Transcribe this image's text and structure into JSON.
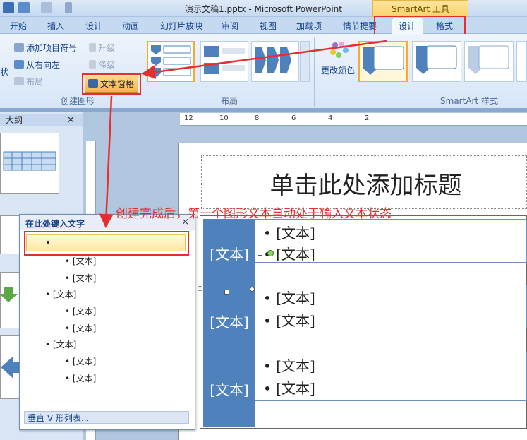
{
  "window": {
    "title": "演示文稿1.pptx - Microsoft PowerPoint",
    "context_tools": "SmartArt 工具"
  },
  "tabs": [
    "开始",
    "插入",
    "设计",
    "动画",
    "幻灯片放映",
    "审阅",
    "视图",
    "加载项",
    "情节提要"
  ],
  "context_tabs": {
    "design": "设计",
    "format": "格式"
  },
  "ribbon": {
    "create_graphic": {
      "add_bullet": "添加项目符号",
      "right_to_left": "从右向左",
      "layout": "布局",
      "promote": "升级",
      "demote": "降级",
      "text_pane": "文本窗格",
      "shape_cut": "状",
      "label": "创建图形"
    },
    "layout_group": {
      "label": "布局"
    },
    "styles_group": {
      "change_colors": "更改颜色",
      "label": "SmartArt 样式"
    }
  },
  "left_panel": {
    "outline_tab": "大纲",
    "close": "×"
  },
  "ruler": {
    "h_marks": [
      "12",
      "10",
      "8",
      "6",
      "4",
      "2"
    ]
  },
  "slide": {
    "title_placeholder": "单击此处添加标题",
    "rows": [
      {
        "chevron": "[文本]",
        "bullets": [
          "[文本]",
          "[文本]"
        ]
      },
      {
        "chevron": "[文本]",
        "bullets": [
          "[文本]",
          "[文本]"
        ]
      },
      {
        "chevron": "[文本]",
        "bullets": [
          "[文本]",
          "[文本]"
        ]
      }
    ]
  },
  "text_pane": {
    "header": "在此处键入文字",
    "close": "×",
    "items": [
      {
        "text": "[文本]",
        "level": 2
      },
      {
        "text": "[文本]",
        "level": 2
      },
      {
        "text": "[文本]",
        "level": 1
      },
      {
        "text": "[文本]",
        "level": 2
      },
      {
        "text": "[文本]",
        "level": 2
      },
      {
        "text": "[文本]",
        "level": 1
      },
      {
        "text": "[文本]",
        "level": 2
      },
      {
        "text": "[文本]",
        "level": 2
      }
    ],
    "footer": "垂直 V 形列表..."
  },
  "annotation": "创建完成后，第一个图形文本自动处于输入文本状态",
  "colors": {
    "accent_red": "#e62e2e",
    "smartart_blue": "#4f81bd",
    "highlight_orange": "#f7b64b"
  }
}
